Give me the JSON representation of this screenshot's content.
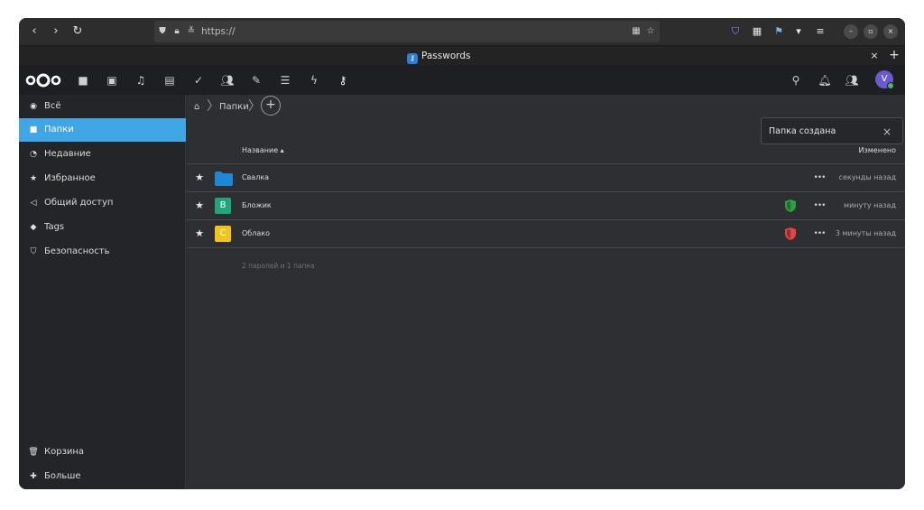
{
  "browser": {
    "nav": {
      "back": "‹",
      "forward": "›",
      "reload": "↻"
    },
    "url": "https://",
    "tab_title": "Passwords",
    "tab_close": "×",
    "tab_new": "+",
    "ext_icons": [
      "extension-shield-icon",
      "extension-grid-icon",
      "extension-flag-icon",
      "dropdown-icon",
      "menu-icon"
    ],
    "window": {
      "minimize": "–",
      "maximize": "▫",
      "close": "×"
    }
  },
  "header": {
    "apps": [
      "files-icon",
      "photos-icon",
      "music-icon",
      "calendar-icon",
      "tasks-icon",
      "contacts-icon",
      "notes-icon",
      "list-icon",
      "activity-icon",
      "passwords-key-icon"
    ],
    "avatar_letter": "V"
  },
  "sidebar": {
    "items": [
      {
        "label": "Всё",
        "icon": "globe-icon"
      },
      {
        "label": "Папки",
        "icon": "folder-icon",
        "active": true
      },
      {
        "label": "Недавние",
        "icon": "clock-icon"
      },
      {
        "label": "Избранное",
        "icon": "star-icon"
      },
      {
        "label": "Общий доступ",
        "icon": "share-icon"
      },
      {
        "label": "Tags",
        "icon": "tag-icon"
      },
      {
        "label": "Безопасность",
        "icon": "shield-icon"
      }
    ],
    "bottom": [
      {
        "label": "Корзина",
        "icon": "trash-icon"
      },
      {
        "label": "Больше",
        "icon": "plus-icon"
      }
    ]
  },
  "breadcrumb": {
    "root": "⌂",
    "current": "Папки",
    "add": "+"
  },
  "table": {
    "col_name": "Название ▴",
    "col_changed": "Изменено",
    "rows": [
      {
        "name": "Свалка",
        "type": "folder",
        "time": "секунды назад"
      },
      {
        "name": "Бложик",
        "type": "password",
        "letter": "B",
        "color": "#1fa67a",
        "security": "#2ea043",
        "time": "минуту назад"
      },
      {
        "name": "Облако",
        "type": "password",
        "letter": "С",
        "color": "#f0c419",
        "security": "#e04545",
        "time": "3 минуты назад"
      }
    ],
    "summary": "2 паролей и 1 папка"
  },
  "toast": {
    "text": "Папка создана",
    "close": "×"
  },
  "colors": {
    "accent": "#41a6e6",
    "folder": "#1e88d8"
  }
}
